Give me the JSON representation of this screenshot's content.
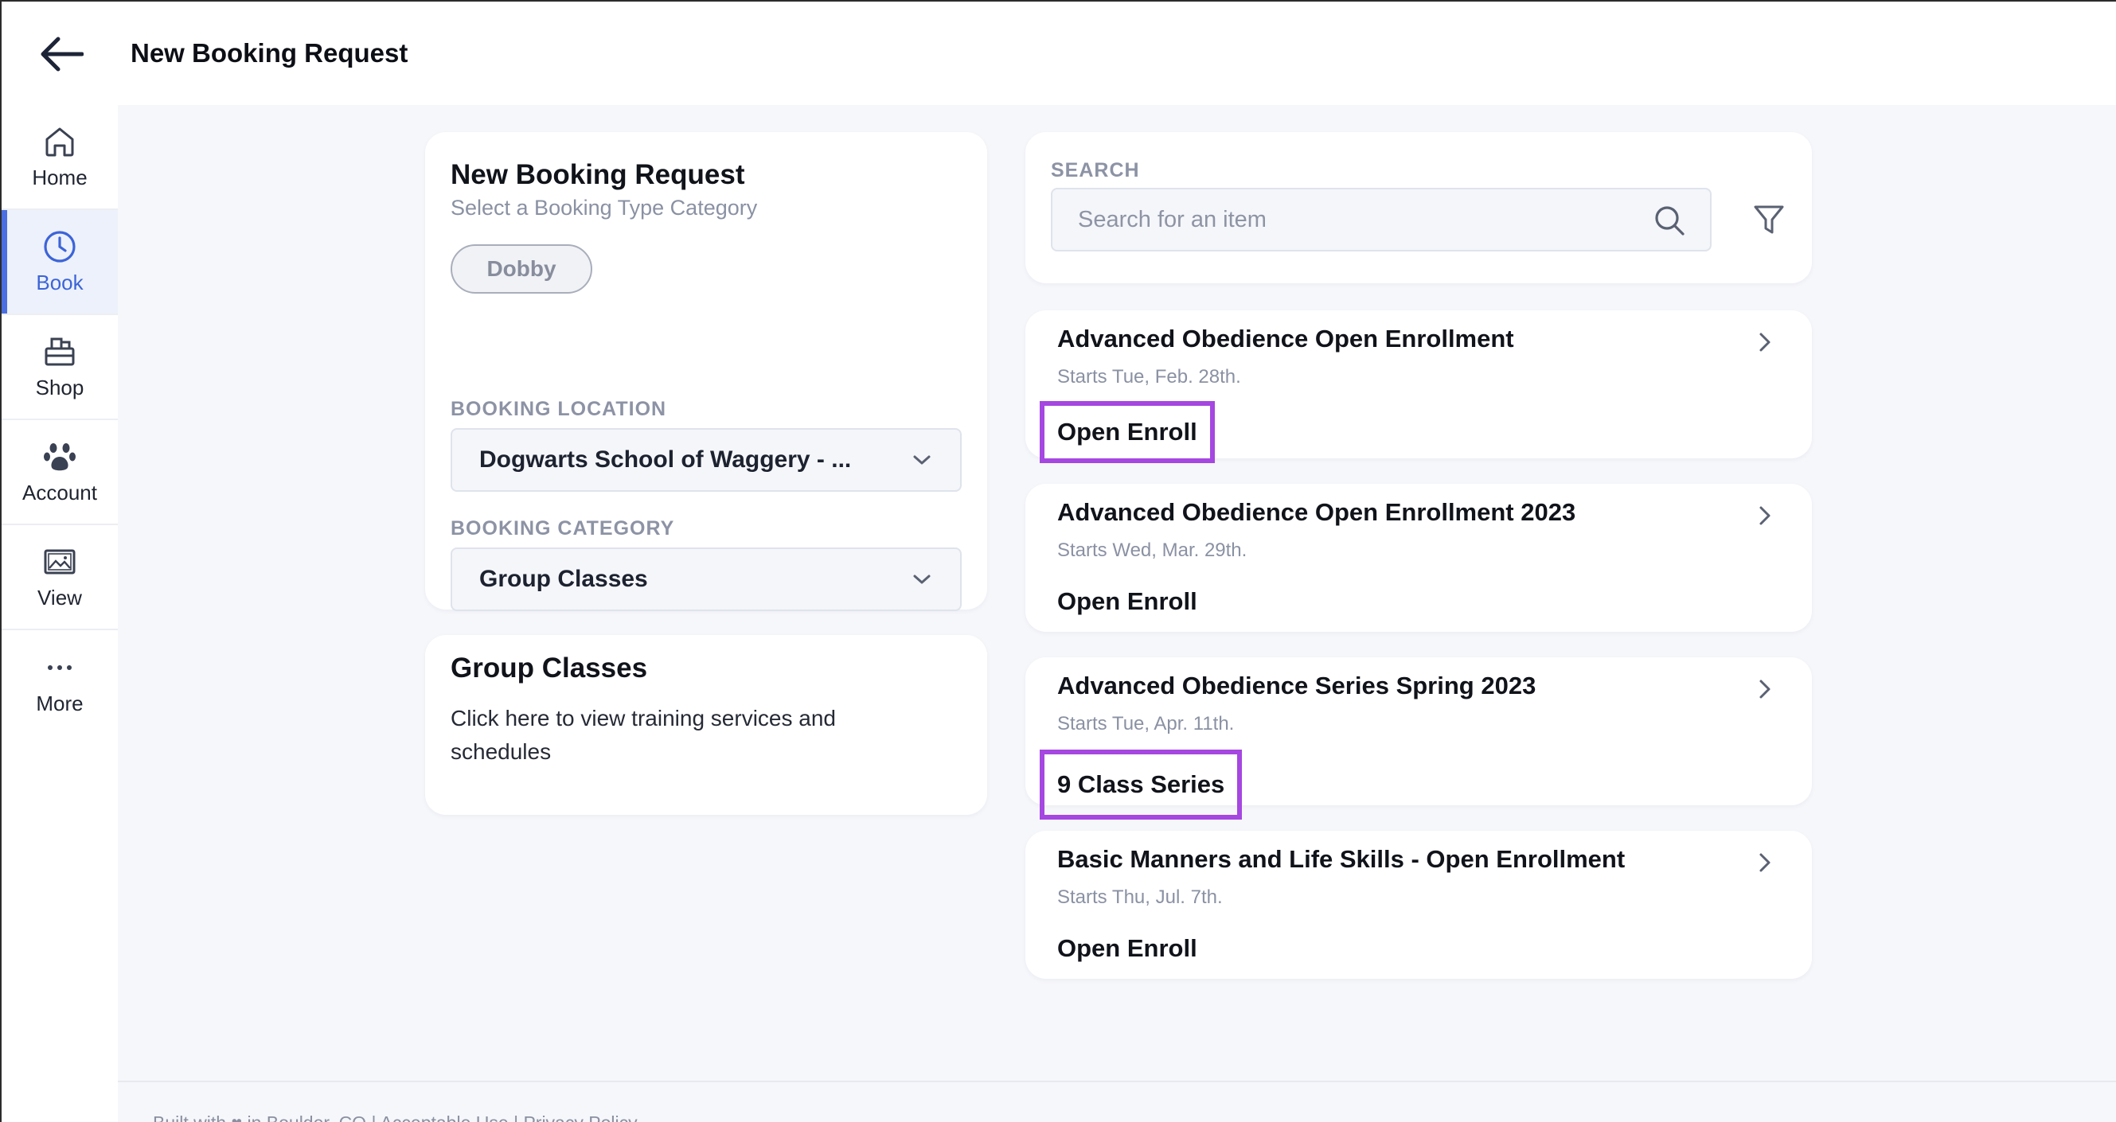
{
  "header": {
    "title": "New Booking Request"
  },
  "sidebar": {
    "items": [
      {
        "label": "Home",
        "icon": "home-icon"
      },
      {
        "label": "Book",
        "icon": "clock-icon"
      },
      {
        "label": "Shop",
        "icon": "shop-icon"
      },
      {
        "label": "Account",
        "icon": "paw-icon"
      },
      {
        "label": "View",
        "icon": "image-icon"
      },
      {
        "label": "More",
        "icon": "more-icon"
      }
    ],
    "active": "Book"
  },
  "booking": {
    "title": "New Booking Request",
    "subtitle": "Select a Booking Type Category",
    "pet_chip": "Dobby",
    "location_label": "BOOKING LOCATION",
    "location_value": "Dogwarts School of Waggery - ...",
    "category_label": "BOOKING CATEGORY",
    "category_value": "Group Classes"
  },
  "group_classes": {
    "title": "Group Classes",
    "description": "Click here to view training services and schedules"
  },
  "search": {
    "label": "SEARCH",
    "placeholder": "Search for an item"
  },
  "items": [
    {
      "title": "Advanced Obedience Open Enrollment",
      "date": "Starts Tue, Feb. 28th.",
      "tag": "Open Enroll",
      "highlighted": true
    },
    {
      "title": "Advanced Obedience Open Enrollment 2023",
      "date": "Starts Wed, Mar. 29th.",
      "tag": "Open Enroll",
      "highlighted": false
    },
    {
      "title": "Advanced Obedience Series Spring 2023",
      "date": "Starts Tue, Apr. 11th.",
      "tag": "9 Class Series",
      "highlighted": true
    },
    {
      "title": "Basic Manners and Life Skills - Open Enrollment",
      "date": "Starts Thu, Jul. 7th.",
      "tag": "Open Enroll",
      "highlighted": false
    }
  ],
  "colors": {
    "accent": "#4b6fe0",
    "highlight": "#a547e0",
    "background": "#f6f7fb"
  },
  "footer": {
    "built_with": "Built with",
    "location": "in Boulder, CO",
    "acceptable_use": "Acceptable Use",
    "privacy": "Privacy Policy"
  }
}
